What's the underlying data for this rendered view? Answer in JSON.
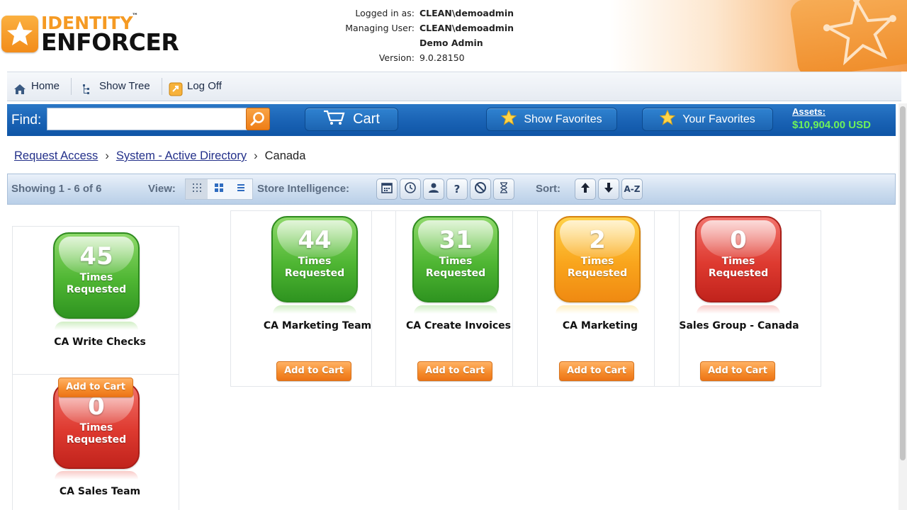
{
  "header": {
    "logo_line1": "IDENTITY",
    "logo_tm": "™",
    "logo_line2": "ENFORCER",
    "session_labels": [
      "Logged in as:",
      "Managing User:",
      "",
      "Version:"
    ],
    "session_values": [
      "CLEAN\\demoadmin",
      "CLEAN\\demoadmin",
      "Demo Admin",
      "9.0.28150"
    ]
  },
  "toolbar": {
    "home": "Home",
    "show_tree": "Show Tree",
    "log_off": "Log Off"
  },
  "findbar": {
    "label": "Find:",
    "search_value": "",
    "cart": "Cart",
    "show_favorites": "Show Favorites",
    "your_favorites": "Your Favorites",
    "assets_label": "Assets:",
    "assets_value": "$10,904.00 USD"
  },
  "breadcrumb": [
    "Request Access",
    "System - Active Directory",
    "Canada"
  ],
  "results": {
    "showing": "Showing 1 - 6 of 6",
    "view_label": "View:",
    "store_intelligence_label": "Store Intelligence:",
    "sort_label": "Sort:",
    "sort_az": "A-Z",
    "help_glyph": "?"
  },
  "items": [
    {
      "name": "CA Write Checks",
      "count": "45",
      "caption1": "Times",
      "caption2": "Requested",
      "color": "green",
      "button": "Add to Cart"
    },
    {
      "name": "CA Marketing Team",
      "count": "44",
      "caption1": "Times",
      "caption2": "Requested",
      "color": "green",
      "button": "Add to Cart"
    },
    {
      "name": "CA Create Invoices",
      "count": "31",
      "caption1": "Times",
      "caption2": "Requested",
      "color": "green",
      "button": "Add to Cart"
    },
    {
      "name": "CA Marketing",
      "count": "2",
      "caption1": "Times",
      "caption2": "Requested",
      "color": "orange",
      "button": "Add to Cart"
    },
    {
      "name": "Sales Group - Canada",
      "count": "0",
      "caption1": "Times",
      "caption2": "Requested",
      "color": "red",
      "button": "Add to Cart"
    },
    {
      "name": "CA Sales Team",
      "count": "0",
      "caption1": "Times",
      "caption2": "Requested",
      "color": "red",
      "button": "Add to Cart"
    }
  ],
  "colors": {
    "brand_orange": "#f59a23",
    "bar_blue": "#1962b4",
    "assets_green": "#6ef05a",
    "link_blue": "#23308a"
  }
}
